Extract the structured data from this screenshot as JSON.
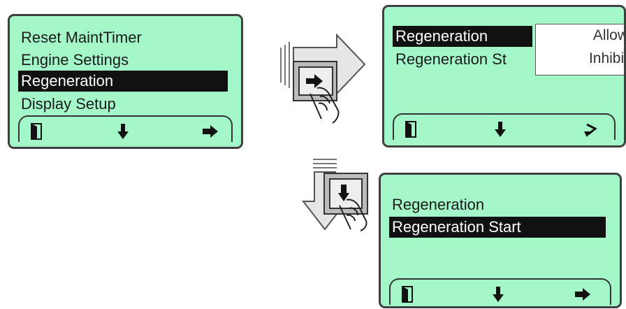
{
  "main_screen": {
    "items": [
      "Reset MaintTimer",
      "Engine Settings",
      "Regeneration",
      "Display Setup"
    ],
    "selected_index": 2,
    "softkeys": [
      "exit-icon",
      "arrow-down-icon",
      "arrow-right-icon"
    ]
  },
  "regeneration_screen": {
    "items": [
      "Regeneration",
      "Regeneration St"
    ],
    "selected_index": 0,
    "popup_options": [
      "Allow",
      "Inhibit"
    ],
    "softkeys": [
      "exit-icon",
      "arrow-down-icon",
      "return-icon"
    ]
  },
  "regeneration_start_screen": {
    "items": [
      "Regeneration",
      "Regeneration Start"
    ],
    "selected_index": 1,
    "softkeys": [
      "exit-icon",
      "arrow-down-icon",
      "arrow-right-icon"
    ]
  },
  "actions": [
    "press-right-key",
    "press-down-key"
  ],
  "colors": {
    "lcd_background": "#a4f7c9",
    "selection": "#111111",
    "frame": "#3f3f3f"
  }
}
